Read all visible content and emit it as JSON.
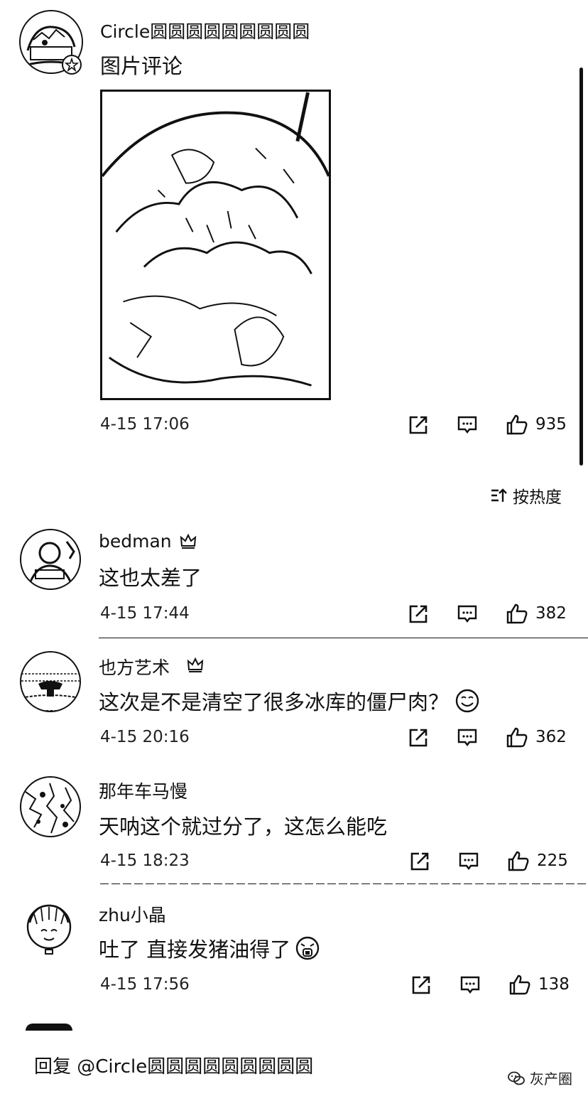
{
  "post": {
    "author": "Circle圆圆圆圆圆圆圆圆圆",
    "text": "图片评论",
    "time": "4-15 17:06",
    "likes": "935"
  },
  "sort_label": "按热度",
  "comments": [
    {
      "name": "bedman",
      "text": "这也太差了",
      "time": "4-15 17:44",
      "likes": "382"
    },
    {
      "name": "也方艺术",
      "text": "这次是不是清空了很多冰库的僵尸肉？",
      "time": "4-15 20:16",
      "likes": "362"
    },
    {
      "name": "那年车马慢",
      "text": "天呐这个就过分了，这怎么能吃",
      "time": "4-15 18:23",
      "likes": "225"
    },
    {
      "name": "zhu小晶",
      "text": "吐了 直接发猪油得了",
      "time": "4-15 17:56",
      "likes": "138"
    }
  ],
  "reply_bar": {
    "label": "回复 @Circle圆圆圆圆圆圆圆圆圆"
  },
  "watermark": {
    "text": "灰产圈"
  },
  "icons": [
    "share-icon",
    "comment-icon",
    "like-icon",
    "sort-icon",
    "crown-badge-icon",
    "smile-emoji-icon",
    "vomit-emoji-icon",
    "wechat-icon"
  ]
}
